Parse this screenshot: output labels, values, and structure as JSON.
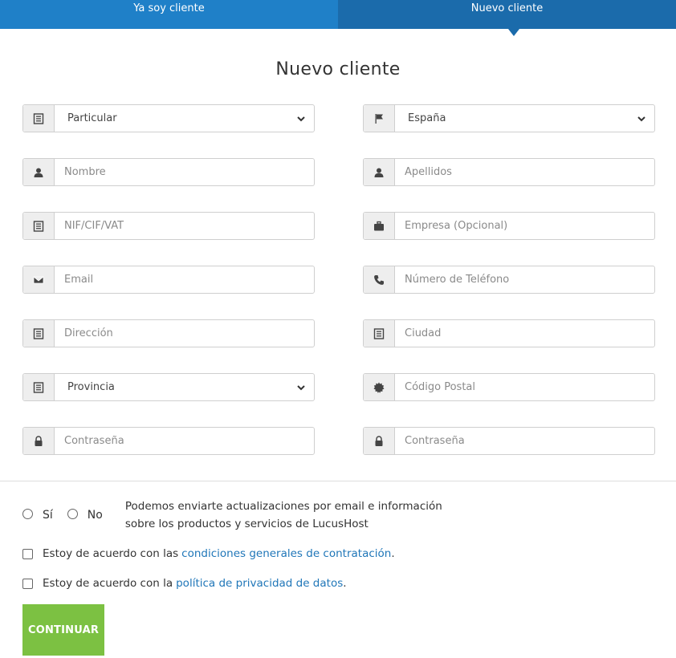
{
  "tabs": {
    "existing": "Ya soy cliente",
    "new": "Nuevo cliente"
  },
  "title": "Nuevo cliente",
  "fields": {
    "customer_type": {
      "value": "Particular",
      "icon": "list-icon"
    },
    "country": {
      "value": "España",
      "icon": "flag-icon"
    },
    "first_name": {
      "placeholder": "Nombre",
      "icon": "user-icon"
    },
    "last_name": {
      "placeholder": "Apellidos",
      "icon": "user-icon"
    },
    "tax_id": {
      "placeholder": "NIF/CIF/VAT",
      "icon": "list-icon"
    },
    "company": {
      "placeholder": "Empresa (Opcional)",
      "icon": "briefcase-icon"
    },
    "email": {
      "placeholder": "Email",
      "icon": "envelope-icon"
    },
    "phone": {
      "placeholder": "Número de Teléfono",
      "icon": "phone-icon"
    },
    "address": {
      "placeholder": "Dirección",
      "icon": "list-icon"
    },
    "city": {
      "placeholder": "Ciudad",
      "icon": "list-icon"
    },
    "province": {
      "value": "Provincia",
      "icon": "list-icon"
    },
    "postal_code": {
      "placeholder": "Código Postal",
      "icon": "badge-icon"
    },
    "password": {
      "placeholder": "Contraseña",
      "icon": "lock-icon"
    },
    "password_confirm": {
      "placeholder": "Contraseña",
      "icon": "lock-icon"
    }
  },
  "newsletter": {
    "yes": "Sí",
    "no": "No",
    "text_line1": "Podemos enviarte actualizaciones por email e información",
    "text_line2": "sobre los productos y servicios de LucusHost"
  },
  "terms": {
    "prefix": "Estoy de acuerdo con las",
    "link": "condiciones generales de contratación",
    "suffix": "."
  },
  "privacy": {
    "prefix": "Estoy de acuerdo con la",
    "link": "política de privacidad de datos",
    "suffix": "."
  },
  "submit_label": "CONTINUAR",
  "colors": {
    "tab_left": "#1f80c8",
    "tab_right": "#1b6bab",
    "button": "#7cc142",
    "link": "#1f76b8"
  }
}
